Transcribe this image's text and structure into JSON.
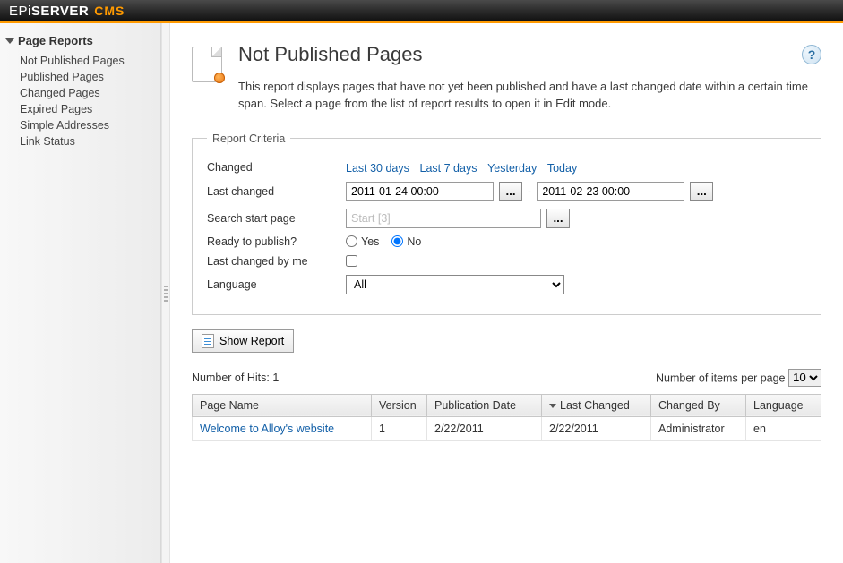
{
  "brand": {
    "epi_prefix": "EPi",
    "epi_bold": "SERVER",
    "suffix": "CMS"
  },
  "sidebar": {
    "section_title": "Page Reports",
    "items": [
      {
        "label": "Not Published Pages"
      },
      {
        "label": "Published Pages"
      },
      {
        "label": "Changed Pages"
      },
      {
        "label": "Expired Pages"
      },
      {
        "label": "Simple Addresses"
      },
      {
        "label": "Link Status"
      }
    ]
  },
  "page": {
    "title": "Not Published Pages",
    "description": "This report displays pages that have not yet been published and have a last changed date within a certain time span. Select a page from the list of report results to open it in Edit mode."
  },
  "criteria": {
    "legend": "Report Criteria",
    "changed_label": "Changed",
    "presets": [
      "Last 30 days",
      "Last 7 days",
      "Yesterday",
      "Today"
    ],
    "last_changed_label": "Last changed",
    "date_from": "2011-01-24 00:00",
    "date_to": "2011-02-23 00:00",
    "date_separator": "-",
    "start_page_label": "Search start page",
    "start_page_placeholder": "Start [3]",
    "ready_label": "Ready to publish?",
    "ready_yes": "Yes",
    "ready_no": "No",
    "ready_selected": "No",
    "by_me_label": "Last changed by me",
    "language_label": "Language",
    "language_value": "All",
    "ellipsis": "..."
  },
  "actions": {
    "show_report": "Show Report"
  },
  "results_meta": {
    "hits_prefix": "Number of Hits:",
    "hits_count": "1",
    "per_page_label": "Number of items per page",
    "per_page_value": "10"
  },
  "table": {
    "columns": {
      "page_name": "Page Name",
      "version": "Version",
      "pub_date": "Publication Date",
      "last_changed": "Last Changed",
      "changed_by": "Changed By",
      "language": "Language"
    },
    "rows": [
      {
        "page_name": "Welcome to Alloy's website",
        "version": "1",
        "pub_date": "2/22/2011",
        "last_changed": "2/22/2011",
        "changed_by": "Administrator",
        "language": "en"
      }
    ]
  },
  "help_glyph": "?"
}
